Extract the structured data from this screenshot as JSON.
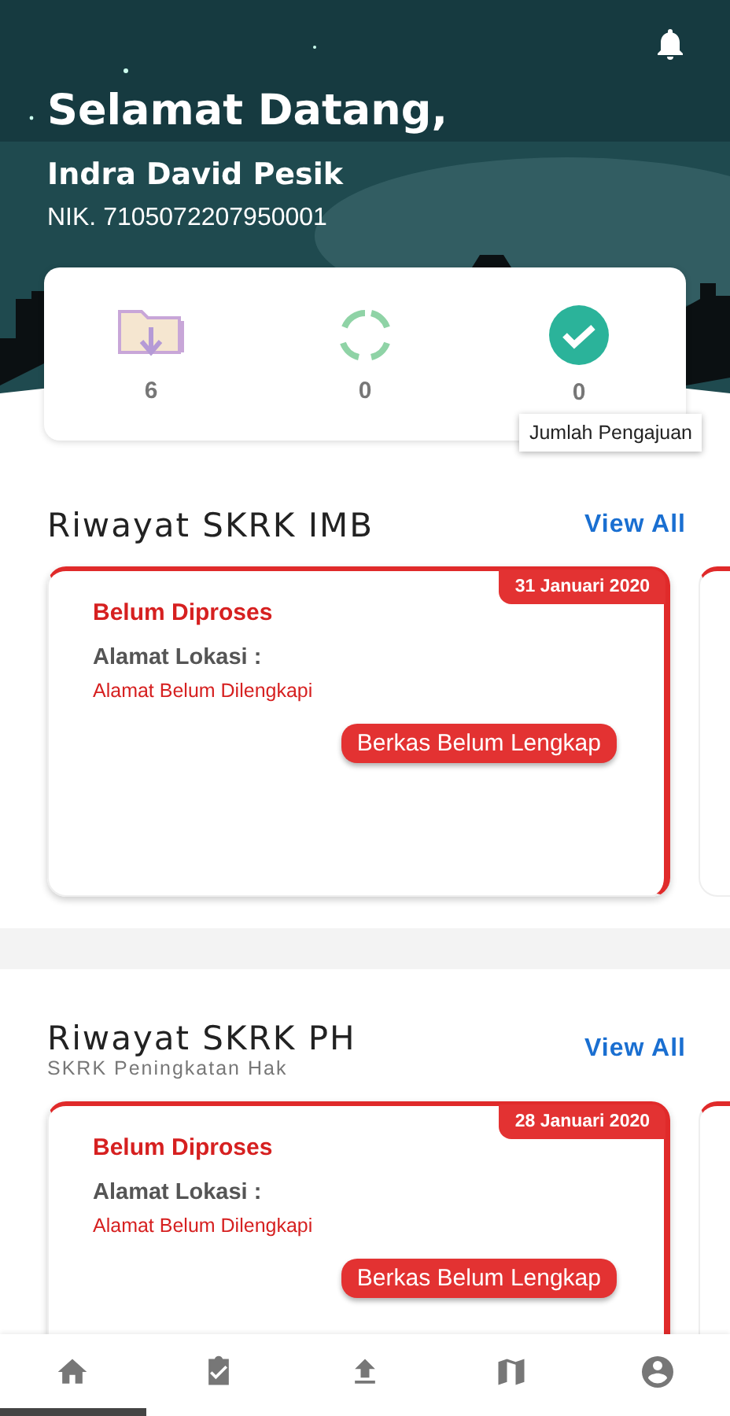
{
  "header": {
    "greeting": "Selamat Datang,",
    "name": "Indra David Pesik",
    "nik": "NIK. 7105072207950001"
  },
  "stats": [
    {
      "kind": "folder",
      "count": "6"
    },
    {
      "kind": "sync",
      "count": "0"
    },
    {
      "kind": "done",
      "count": "0"
    }
  ],
  "tooltip": "Jumlah Pengajuan",
  "sections": [
    {
      "title": "Riwayat SKRK IMB",
      "link": "View All",
      "cards": [
        {
          "date": "31 Januari 2020",
          "status": "Belum Diproses",
          "address_label": "Alamat Lokasi :",
          "address": "Alamat Belum Dilengkapi",
          "badge": "Berkas Belum Lengkap"
        }
      ]
    },
    {
      "title": "Riwayat SKRK PH",
      "subtitle": "SKRK Peningkatan Hak",
      "link": "View All",
      "cards": [
        {
          "date": "28 Januari 2020",
          "status": "Belum Diproses",
          "address_label": "Alamat Lokasi :",
          "address": "Alamat Belum Dilengkapi",
          "badge": "Berkas Belum Lengkap"
        }
      ]
    }
  ],
  "bottom_nav": [
    {
      "kind": "home",
      "selected": true
    },
    {
      "kind": "tasks",
      "selected": false
    },
    {
      "kind": "upload",
      "selected": false
    },
    {
      "kind": "map",
      "selected": false
    },
    {
      "kind": "profile",
      "selected": false
    }
  ]
}
